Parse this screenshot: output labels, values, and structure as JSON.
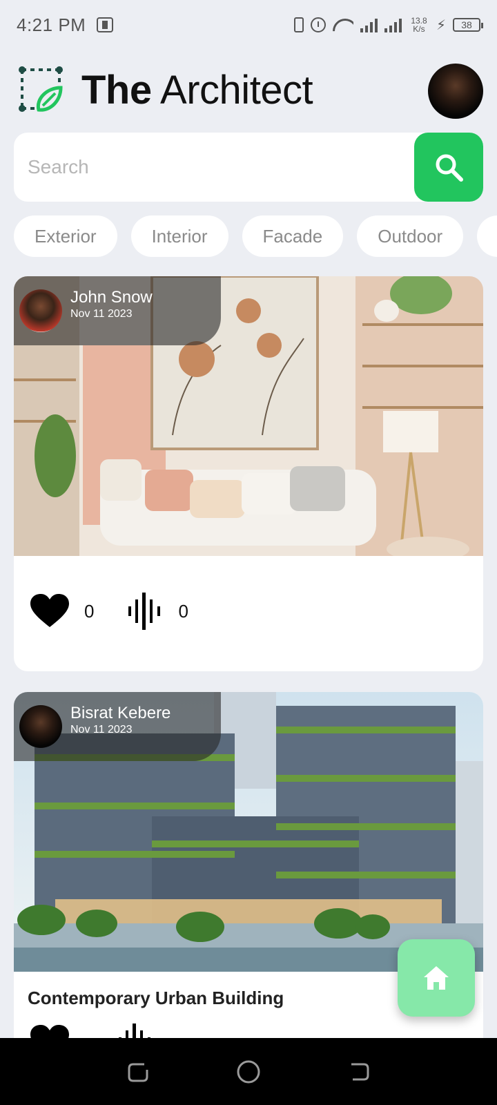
{
  "status_bar": {
    "time": "4:21 PM",
    "net_speed_value": "13.8",
    "net_speed_unit": "K/s",
    "battery": "38"
  },
  "header": {
    "title_bold": "The",
    "title_light": "Architect"
  },
  "search": {
    "placeholder": "Search"
  },
  "categories": [
    "Exterior",
    "Interior",
    "Facade",
    "Outdoor",
    ""
  ],
  "posts": [
    {
      "author": "John Snow",
      "date": "Nov 11 2023",
      "title": "",
      "likes": "0",
      "listens": "0"
    },
    {
      "author": "Bisrat Kebere",
      "date": "Nov 11 2023",
      "title": "Contemporary Urban Building",
      "likes": "",
      "listens": ""
    }
  ],
  "colors": {
    "accent": "#22c55e",
    "fab": "#86e8a9",
    "background": "#eceef3",
    "logo_dark": "#1f4d45"
  },
  "icons": {
    "search": "search-icon",
    "like": "heart-icon",
    "listen": "audio-wave-icon",
    "fab": "home-icon"
  }
}
